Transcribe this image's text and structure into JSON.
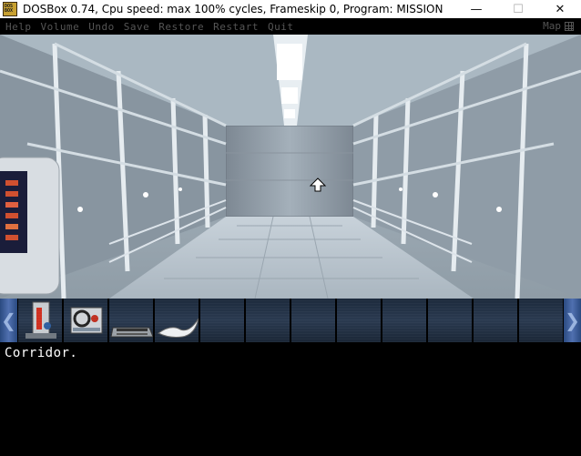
{
  "window": {
    "title": "DOSBox 0.74, Cpu speed: max 100% cycles, Frameskip  0, Program:  MISSION",
    "icon_text": "DOS BOX",
    "controls": [
      "—",
      "☐",
      "✕"
    ]
  },
  "menu": {
    "items": [
      "Help",
      "Volume",
      "Undo",
      "Save",
      "Restore",
      "Restart",
      "Quit"
    ],
    "map_label": "Map"
  },
  "inventory": {
    "left_arrow": "❮",
    "right_arrow": "❯",
    "items": [
      "lab-device-icon",
      "tape-recorder-icon",
      "keyboard-panel-icon",
      "cloth-icon",
      "",
      "",
      "",
      "",
      "",
      "",
      "",
      ""
    ]
  },
  "message": "Corridor."
}
